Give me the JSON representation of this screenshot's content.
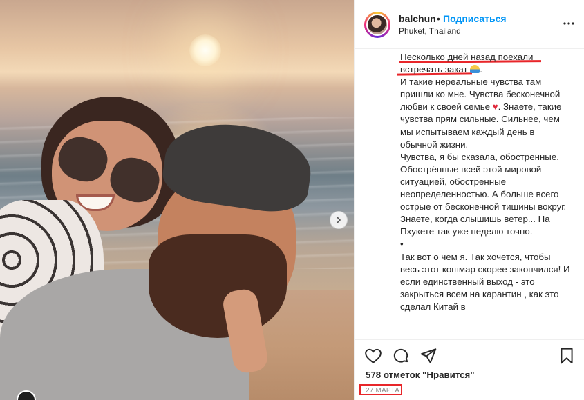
{
  "post": {
    "username": "balchun",
    "separator": "•",
    "follow_label": "Подписаться",
    "location": "Phuket, Thailand"
  },
  "caption": {
    "line1": "Несколько дней назад поехали",
    "line2": "встречать закат",
    "line2_suffix": ".",
    "para1": "И такие нереальные чувства там пришли ко мне. Чувства бесконечной любви к своей семье",
    "para1_suffix": ". Знаете, такие чувства прям сильные. Сильнее, чем мы испытываем каждый день в обычной жизни.",
    "para2": "Чувства, я бы сказала, обостренные. Обострённые всей этой мировой ситуацией, обостренные неопределенностью. А больше всего острые от бесконечной тишины вокруг. Знаете, когда слышишь ветер... На Пхукете так уже неделю точно.",
    "bullet": "•",
    "para3": "Так вот о чем я. Так хочется, чтобы весь этот кошмар скорее закончился! И если единственный выход - это закрыться всем на карантин , как это сделал Китай в"
  },
  "icons": {
    "heart_emoji": "♥",
    "more": "more-options-icon",
    "like": "heart-icon",
    "comment": "comment-icon",
    "share": "share-icon",
    "save": "bookmark-icon",
    "next": "chevron-right-icon"
  },
  "stats": {
    "likes": "578 отметок \"Нравится\"",
    "date": "27 МАРТА"
  },
  "colors": {
    "accent_blue": "#0095f6",
    "annotation_red": "#e8262a",
    "text": "#262626",
    "muted": "#8e8e8e"
  }
}
